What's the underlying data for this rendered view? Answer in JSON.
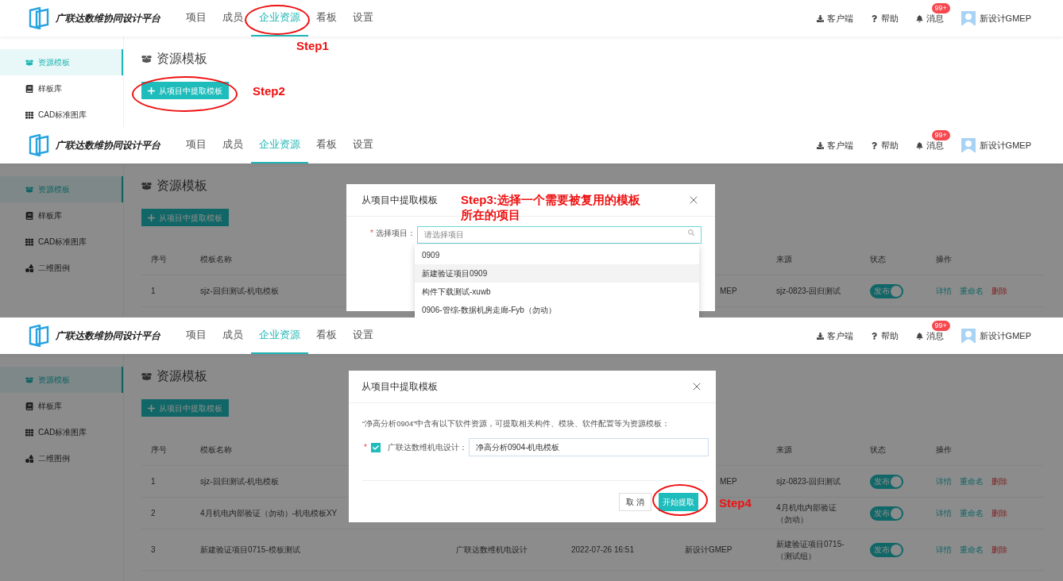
{
  "panels": [
    {
      "header": {
        "logo": "广联达数维协同设计平台",
        "nav": [
          {
            "label": "项目",
            "selected": false
          },
          {
            "label": "成员",
            "selected": false
          },
          {
            "label": "企业资源",
            "selected": true
          },
          {
            "label": "看板",
            "selected": false
          },
          {
            "label": "设置",
            "selected": false
          }
        ],
        "tools": [
          {
            "kind": "download",
            "label": "客户端"
          },
          {
            "kind": "help",
            "label": "帮助"
          },
          {
            "kind": "bell",
            "label": "消息",
            "badge": "99+"
          }
        ],
        "user": "新设计GMEP"
      },
      "sidebar": [
        {
          "kind": "box",
          "label": "资源模板",
          "selected": true
        },
        {
          "kind": "book",
          "label": "样板库",
          "selected": false
        },
        {
          "kind": "grid",
          "label": "CAD标准图库",
          "selected": false
        }
      ],
      "page_title": "资源模板",
      "primary_button": "从项目中提取模板",
      "annotations": [
        {
          "kind": "ellipse"
        },
        {
          "kind": "label",
          "lines": [
            "Step1"
          ]
        },
        {
          "kind": "ellipse"
        },
        {
          "kind": "label",
          "lines": [
            "Step2"
          ]
        }
      ]
    },
    {
      "header": {
        "logo": "广联达数维协同设计平台",
        "nav": [
          {
            "label": "项目",
            "selected": false
          },
          {
            "label": "成员",
            "selected": false
          },
          {
            "label": "企业资源",
            "selected": true
          },
          {
            "label": "看板",
            "selected": false
          },
          {
            "label": "设置",
            "selected": false
          }
        ],
        "tools": [
          {
            "kind": "download",
            "label": "客户端"
          },
          {
            "kind": "help",
            "label": "帮助"
          },
          {
            "kind": "bell",
            "label": "消息",
            "badge": "99+"
          }
        ],
        "user": "新设计GMEP"
      },
      "sidebar": [
        {
          "kind": "box",
          "label": "资源模板",
          "selected": true
        },
        {
          "kind": "book",
          "label": "样板库",
          "selected": false
        },
        {
          "kind": "grid",
          "label": "CAD标准图库",
          "selected": false
        },
        {
          "kind": "shapes",
          "label": "二维图例",
          "selected": false
        }
      ],
      "page_title": "资源模板",
      "primary_button": "从项目中提取模板",
      "table": {
        "header": {
          "no": "序号",
          "name": "模板名称",
          "source": "来源",
          "status": "状态",
          "actions": "操作"
        },
        "rows": [
          {
            "no": "1",
            "name": "sjz-回归测试-机电模板",
            "creator": "MEP",
            "source": "sjz-0823-回归测试",
            "status": {
              "label": "发布",
              "on": true
            },
            "actions": [
              {
                "label": "详情",
                "kind": "link"
              },
              {
                "label": "重命名",
                "kind": "link"
              },
              {
                "label": "删除",
                "kind": "danger"
              }
            ]
          }
        ]
      },
      "modal": {
        "kind": "select",
        "title": "从项目中提取模板",
        "field_label": "选择项目：",
        "required_mark": "*",
        "placeholder": "请选择项目",
        "options": [
          {
            "label": "0909",
            "highlighted": false
          },
          {
            "label": "新建验证项目0909",
            "highlighted": true
          },
          {
            "label": "构件下载测试-xuwb",
            "highlighted": false
          },
          {
            "label": "0906-管综-数据机房走廊-Fyb（勿动）",
            "highlighted": false
          }
        ]
      },
      "annotations": [
        {
          "kind": "label",
          "lines": [
            "Step3:选择一个需要被复用的模板",
            "所在的项目"
          ]
        }
      ]
    },
    {
      "header": {
        "logo": "广联达数维协同设计平台",
        "nav": [
          {
            "label": "项目",
            "selected": false
          },
          {
            "label": "成员",
            "selected": false
          },
          {
            "label": "企业资源",
            "selected": true
          },
          {
            "label": "看板",
            "selected": false
          },
          {
            "label": "设置",
            "selected": false
          }
        ],
        "tools": [
          {
            "kind": "download",
            "label": "客户端"
          },
          {
            "kind": "help",
            "label": "帮助"
          },
          {
            "kind": "bell",
            "label": "消息",
            "badge": "99+"
          }
        ],
        "user": "新设计GMEP"
      },
      "sidebar": [
        {
          "kind": "box",
          "label": "资源模板",
          "selected": true
        },
        {
          "kind": "book",
          "label": "样板库",
          "selected": false
        },
        {
          "kind": "grid",
          "label": "CAD标准图库",
          "selected": false
        },
        {
          "kind": "shapes",
          "label": "二维图例",
          "selected": false
        }
      ],
      "page_title": "资源模板",
      "primary_button": "从项目中提取模板",
      "table": {
        "header": {
          "no": "序号",
          "name": "模板名称",
          "source": "来源",
          "status": "状态",
          "actions": "操作"
        },
        "rows": [
          {
            "no": "1",
            "name": "sjz-回归测试-机电模板",
            "creator": "MEP",
            "source": "sjz-0823-回归测试",
            "status": {
              "label": "发布",
              "on": true
            },
            "actions": [
              {
                "label": "详情",
                "kind": "link"
              },
              {
                "label": "重命名",
                "kind": "link"
              },
              {
                "label": "删除",
                "kind": "danger"
              }
            ]
          },
          {
            "no": "2",
            "name": "4月机电内部验证（勿动）-机电模板XY",
            "source": "4月机电内部验证（勿动）",
            "status": {
              "label": "发布",
              "on": true
            },
            "actions": [
              {
                "label": "详情",
                "kind": "link"
              },
              {
                "label": "重命名",
                "kind": "link"
              },
              {
                "label": "删除",
                "kind": "danger"
              }
            ]
          },
          {
            "no": "3",
            "name": "新建验证项目0715-模板测试",
            "software": "广联达数维机电设计",
            "time": "2022-07-26 16:51",
            "creator": "新设计GMEP",
            "source": "新建验证项目0715-（测试组）",
            "status": {
              "label": "发布",
              "on": true
            },
            "actions": [
              {
                "label": "详情",
                "kind": "link"
              },
              {
                "label": "重命名",
                "kind": "link"
              },
              {
                "label": "删除",
                "kind": "danger"
              }
            ]
          }
        ]
      },
      "modal": {
        "kind": "extract",
        "title": "从项目中提取模板",
        "description": "“净高分析0904”中含有以下软件资源，可提取相关构件、模块、软件配置等为资源模板：",
        "required_mark": "*",
        "checked": true,
        "field_label": "广联达数维机电设计：",
        "value": "净高分析0904-机电模板",
        "cancel": "取 消",
        "confirm": "开始提取"
      },
      "annotations": [
        {
          "kind": "ellipse"
        },
        {
          "kind": "label",
          "lines": [
            "Step4"
          ]
        }
      ]
    }
  ]
}
